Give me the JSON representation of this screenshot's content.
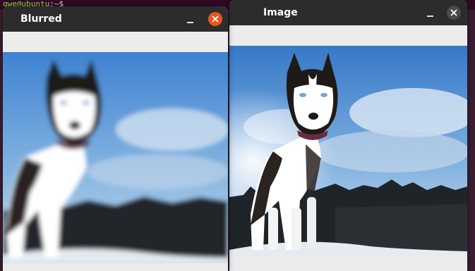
{
  "terminal": {
    "prompt_user_host": "qwe@ubuntu",
    "prompt_path": ":~$"
  },
  "windows": {
    "image": {
      "title": "Image",
      "minimize_symbol": "_",
      "close_symbol": "×",
      "close_color": "#4a4a4a"
    },
    "blurred": {
      "title": "Blurred",
      "minimize_symbol": "_",
      "close_symbol": "×",
      "close_color": "#e95420"
    }
  },
  "colors": {
    "titlebar": "#2c2c2c",
    "window_bg": "#ececec",
    "sky_top": "#3a7fd0",
    "sky_bottom": "#c9dcef",
    "treeline": "#1e2326",
    "snow": "#e8ecf2"
  }
}
